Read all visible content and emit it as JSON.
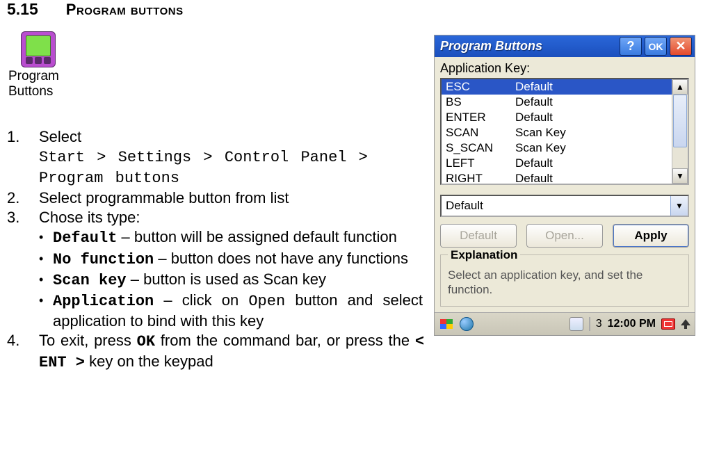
{
  "heading": {
    "num": "5.15",
    "title": "Program buttons"
  },
  "icon": {
    "caption_l1": "Program",
    "caption_l2": "Buttons"
  },
  "steps": {
    "s1_num": "1.",
    "s1_lead": "Select",
    "s1_path": "Start > Settings > Control Panel > Program buttons",
    "s2_num": "2.",
    "s2_text": "Select programmable button from list",
    "s3_num": "3.",
    "s3_text": "Chose its type:",
    "s3a_term": "Default",
    "s3a_rest": " – button will be assigned default function",
    "s3b_term": "No function",
    "s3b_rest": " – button does not have any functions",
    "s3c_term": "Scan key",
    "s3c_rest": "  – button is used as Scan key",
    "s3d_term": "Application",
    "s3d_rest_a": " – click on ",
    "s3d_open": "Open",
    "s3d_rest_b": " button and select application to bind with this key",
    "s4_num": "4.",
    "s4_a": "To exit, press ",
    "s4_ok": "OK",
    "s4_b": " from the command bar, or press the ",
    "s4_ent": "< ENT >",
    "s4_c": " key on the keypad"
  },
  "shot": {
    "title": "Program Buttons",
    "help": "?",
    "ok": "OK",
    "close": "✕",
    "label": "Application Key:",
    "rows": [
      {
        "k": "ESC",
        "v": "Default",
        "sel": true
      },
      {
        "k": "BS",
        "v": "Default",
        "sel": false
      },
      {
        "k": "ENTER",
        "v": "Default",
        "sel": false
      },
      {
        "k": "SCAN",
        "v": "Scan Key",
        "sel": false
      },
      {
        "k": "S_SCAN",
        "v": "Scan Key",
        "sel": false
      },
      {
        "k": "LEFT",
        "v": "Default",
        "sel": false
      },
      {
        "k": "RIGHT",
        "v": "Default",
        "sel": false
      }
    ],
    "combo_value": "Default",
    "btn_default": "Default",
    "btn_open": "Open...",
    "btn_apply": "Apply",
    "group_title": "Explanation",
    "group_text": "Select an application key, and set the function.",
    "clock": "12:00 PM",
    "tray_num": "3"
  }
}
